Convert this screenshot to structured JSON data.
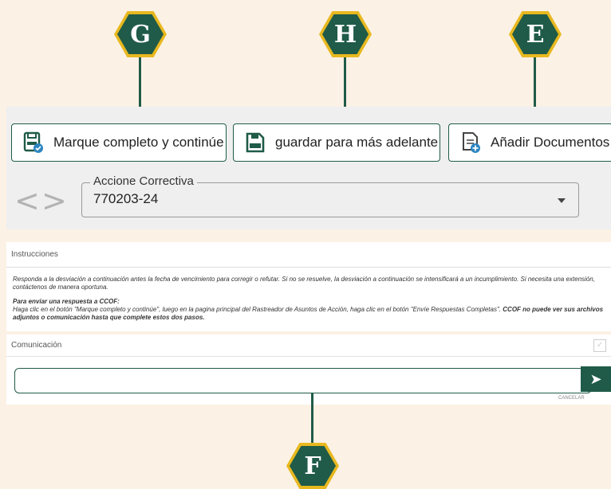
{
  "badges": {
    "g": "G",
    "h": "H",
    "e": "E",
    "f": "F"
  },
  "toolbar": {
    "mark_complete_label": "Marque completo y continúe",
    "save_later_label": "guardar para más adelante",
    "add_documents_label": "Añadir Documentos"
  },
  "selector": {
    "legend": "Accione Correctiva",
    "value": "770203-24"
  },
  "nav": {
    "prev": "<",
    "next": ">"
  },
  "instructions": {
    "title": "Instrucciones",
    "paragraph": "Responda a la desviación a continuación antes la fecha de vencimiento para corregir o refutar. Si no se resuelve, la desviación a continuación se intensificará a un incumplimiento. Si necesita una extensión, contáctenos de manera oportuna.",
    "how_to_title": "Para enviar una respuesta a CCOF:",
    "how_to_text": "Haga clic en el botón \"Marque completo y continúe\", luego en la pagina principal del Rastreador de Asuntos de Acción, haga clic en el botón \"Envíe Respuestas Completas\".",
    "warning": "CCOF no puede ver sus archivos adjuntos o comunicación hasta que complete estos dos pasos."
  },
  "communication": {
    "title": "Comunicación",
    "input_value": "",
    "send_icon": "send-icon",
    "cancel_label": "CANCELAR"
  },
  "colors": {
    "brand_green": "#1f5b48",
    "badge_gold": "#e8b81f",
    "background": "#fbf1e4"
  }
}
